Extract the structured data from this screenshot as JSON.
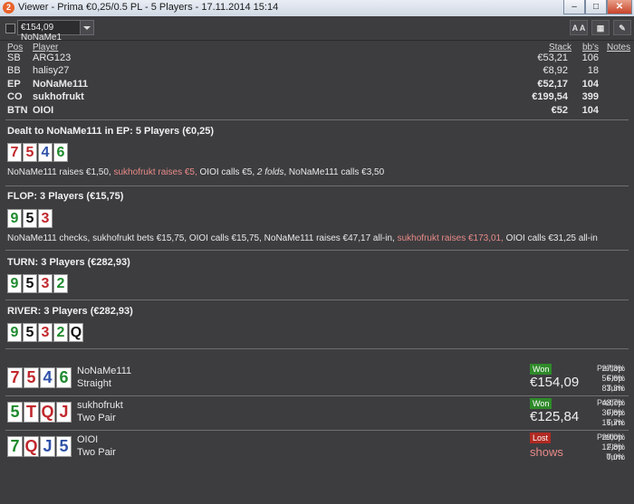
{
  "window": {
    "title": "Viewer - Prima €0,25/0.5 PL - 5 Players - 17.11.2014 15:14",
    "app_icon": "2",
    "min": "–",
    "max": "□",
    "close": "✕"
  },
  "toolbar": {
    "combo_value": "€154,09 NoNaMe1",
    "font_btn": "A A",
    "grid_btn": "▦",
    "edit_btn": "✎"
  },
  "table_header": {
    "pos": "Pos",
    "player": "Player",
    "stack": "Stack",
    "bbs": "bb's",
    "notes": "Notes"
  },
  "players": [
    {
      "pos": "SB",
      "name": "ARG123",
      "stack": "€53,21",
      "bbs": "106",
      "bold": false
    },
    {
      "pos": "BB",
      "name": "halisy27",
      "stack": "€8,92",
      "bbs": "18",
      "bold": false
    },
    {
      "pos": "EP",
      "name": "NoNaMe111",
      "stack": "€52,17",
      "bbs": "104",
      "bold": true
    },
    {
      "pos": "CO",
      "name": "sukhofrukt",
      "stack": "€199,54",
      "bbs": "399",
      "bold": true
    },
    {
      "pos": "BTN",
      "name": "OIOI",
      "stack": "€52",
      "bbs": "104",
      "bold": true
    }
  ],
  "preflop": {
    "title": "Dealt to NoNaMe111 in EP: 5 Players (€0,25)",
    "cards": [
      {
        "r": "7",
        "c": "red"
      },
      {
        "r": "5",
        "c": "red"
      },
      {
        "r": "4",
        "c": "blue"
      },
      {
        "r": "6",
        "c": "green"
      }
    ],
    "a1": "NoNaMe111 raises €1,50, ",
    "a2": "sukhofrukt raises €5,",
    "a3": " OIOI calls €5, ",
    "a4": "2 folds",
    "a5": ", NoNaMe111 calls €3,50"
  },
  "flop": {
    "title": "FLOP: 3 Players (€15,75)",
    "cards": [
      {
        "r": "9",
        "c": "green"
      },
      {
        "r": "5",
        "c": "black"
      },
      {
        "r": "3",
        "c": "red"
      }
    ],
    "a1": "NoNaMe111 checks, sukhofrukt bets €15,75, OIOI calls €15,75, NoNaMe111 raises €47,17 all-in, ",
    "a2": "sukhofrukt raises €173,01,",
    "a3": " OIOI calls €31,25 all-in"
  },
  "turn": {
    "title": "TURN: 3 Players (€282,93)",
    "cards": [
      {
        "r": "9",
        "c": "green"
      },
      {
        "r": "5",
        "c": "black"
      },
      {
        "r": "3",
        "c": "red"
      },
      {
        "r": "2",
        "c": "green"
      }
    ]
  },
  "river": {
    "title": "RIVER: 3 Players (€282,93)",
    "cards": [
      {
        "r": "9",
        "c": "green"
      },
      {
        "r": "5",
        "c": "black"
      },
      {
        "r": "3",
        "c": "red"
      },
      {
        "r": "2",
        "c": "green"
      },
      {
        "r": "Q",
        "c": "black"
      }
    ]
  },
  "results": [
    {
      "cards": [
        {
          "r": "7",
          "c": "red"
        },
        {
          "r": "5",
          "c": "red"
        },
        {
          "r": "4",
          "c": "blue"
        },
        {
          "r": "6",
          "c": "green"
        }
      ],
      "name": "NoNaMe111",
      "hand": "Straight",
      "badge": "Won",
      "amount": "€154,09",
      "preflop": "27,3%",
      "flop": "56,6%",
      "turn": "83,3%"
    },
    {
      "cards": [
        {
          "r": "5",
          "c": "green"
        },
        {
          "r": "T",
          "c": "red"
        },
        {
          "r": "Q",
          "c": "red"
        },
        {
          "r": "J",
          "c": "red"
        }
      ],
      "name": "sukhofrukt",
      "hand": "Two Pair",
      "badge": "Won",
      "amount": "€125,84",
      "preflop": "43,7%",
      "flop": "30,6%",
      "turn": "16,7%"
    },
    {
      "cards": [
        {
          "r": "7",
          "c": "green"
        },
        {
          "r": "Q",
          "c": "red"
        },
        {
          "r": "J",
          "c": "blue"
        },
        {
          "r": "5",
          "c": "blue"
        }
      ],
      "name": "OIOI",
      "hand": "Two Pair",
      "badge": "Lost",
      "amount": "shows",
      "preflop": "29,0%",
      "flop": "12,8%",
      "turn": "0,0%"
    }
  ],
  "stat_labels": {
    "preflop": "Preflop:",
    "flop": "Flop:",
    "turn": "Turn:"
  }
}
